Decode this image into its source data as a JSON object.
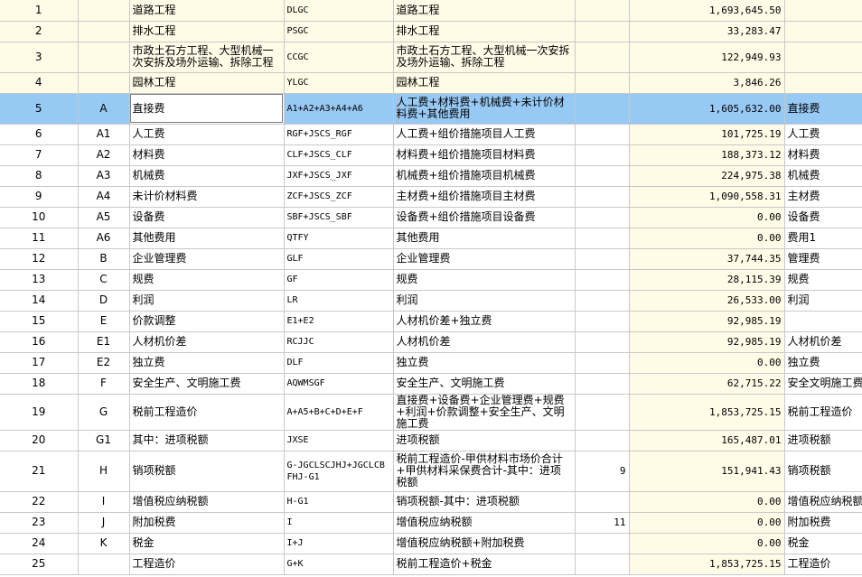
{
  "columns": [
    "no",
    "code",
    "name",
    "base",
    "desc",
    "rate",
    "amount",
    "category"
  ],
  "rows": [
    {
      "no": "1",
      "code": "",
      "name": "道路工程",
      "base": "DLGC",
      "desc": "道路工程",
      "rate": "",
      "amount": "1,693,645.50",
      "category": ""
    },
    {
      "no": "2",
      "code": "",
      "name": "排水工程",
      "base": "PSGC",
      "desc": "排水工程",
      "rate": "",
      "amount": "33,283.47",
      "category": ""
    },
    {
      "no": "3",
      "code": "",
      "name": "市政土石方工程、大型机械一次安拆及场外运输、拆除工程",
      "base": "CCGC",
      "desc": "市政土石方工程、大型机械一次安拆及场外运输、拆除工程",
      "rate": "",
      "amount": "122,949.93",
      "category": ""
    },
    {
      "no": "4",
      "code": "",
      "name": "园林工程",
      "base": "YLGC",
      "desc": "园林工程",
      "rate": "",
      "amount": "3,846.26",
      "category": ""
    },
    {
      "no": "5",
      "code": "A",
      "name": "直接费",
      "base": "A1+A2+A3+A4+A6",
      "desc": "人工费+材料费+机械费+未计价材料费+其他费用",
      "rate": "",
      "amount": "1,605,632.00",
      "category": "直接费"
    },
    {
      "no": "6",
      "code": "A1",
      "name": "人工费",
      "base": "RGF+JSCS_RGF",
      "desc": "人工费+组价措施项目人工费",
      "rate": "",
      "amount": "101,725.19",
      "category": "人工费"
    },
    {
      "no": "7",
      "code": "A2",
      "name": "材料费",
      "base": "CLF+JSCS_CLF",
      "desc": "材料费+组价措施项目材料费",
      "rate": "",
      "amount": "188,373.12",
      "category": "材料费"
    },
    {
      "no": "8",
      "code": "A3",
      "name": "机械费",
      "base": "JXF+JSCS_JXF",
      "desc": "机械费+组价措施项目机械费",
      "rate": "",
      "amount": "224,975.38",
      "category": "机械费"
    },
    {
      "no": "9",
      "code": "A4",
      "name": "未计价材料费",
      "base": "ZCF+JSCS_ZCF",
      "desc": "主材费+组价措施项目主材费",
      "rate": "",
      "amount": "1,090,558.31",
      "category": "主材费"
    },
    {
      "no": "10",
      "code": "A5",
      "name": "设备费",
      "base": "SBF+JSCS_SBF",
      "desc": "设备费+组价措施项目设备费",
      "rate": "",
      "amount": "0.00",
      "category": "设备费"
    },
    {
      "no": "11",
      "code": "A6",
      "name": "其他费用",
      "base": "QTFY",
      "desc": "其他费用",
      "rate": "",
      "amount": "0.00",
      "category": "费用1"
    },
    {
      "no": "12",
      "code": "B",
      "name": "企业管理费",
      "base": "GLF",
      "desc": "企业管理费",
      "rate": "",
      "amount": "37,744.35",
      "category": "管理费"
    },
    {
      "no": "13",
      "code": "C",
      "name": "规费",
      "base": "GF",
      "desc": "规费",
      "rate": "",
      "amount": "28,115.39",
      "category": "规费"
    },
    {
      "no": "14",
      "code": "D",
      "name": "利润",
      "base": "LR",
      "desc": "利润",
      "rate": "",
      "amount": "26,533.00",
      "category": "利润"
    },
    {
      "no": "15",
      "code": "E",
      "name": "价款调整",
      "base": "E1+E2",
      "desc": "人材机价差+独立费",
      "rate": "",
      "amount": "92,985.19",
      "category": ""
    },
    {
      "no": "16",
      "code": "E1",
      "name": "人材机价差",
      "base": "RCJJC",
      "desc": "人材机价差",
      "rate": "",
      "amount": "92,985.19",
      "category": "人材机价差"
    },
    {
      "no": "17",
      "code": "E2",
      "name": "独立费",
      "base": "DLF",
      "desc": "独立费",
      "rate": "",
      "amount": "0.00",
      "category": "独立费"
    },
    {
      "no": "18",
      "code": "F",
      "name": "安全生产、文明施工费",
      "base": "AQWMSGF",
      "desc": "安全生产、文明施工费",
      "rate": "",
      "amount": "62,715.22",
      "category": "安全文明施工费"
    },
    {
      "no": "19",
      "code": "G",
      "name": "税前工程造价",
      "base": "A+A5+B+C+D+E+F",
      "desc": "直接费+设备费+企业管理费+规费+利润+价款调整+安全生产、文明施工费",
      "rate": "",
      "amount": "1,853,725.15",
      "category": "税前工程造价"
    },
    {
      "no": "20",
      "code": "G1",
      "name": "其中：进项税额",
      "base": "JXSE",
      "desc": "进项税额",
      "rate": "",
      "amount": "165,487.01",
      "category": "进项税额"
    },
    {
      "no": "21",
      "code": "H",
      "name": "销项税额",
      "base": "G-JGCLSCJHJ+JGCLCBFHJ-G1",
      "desc": "税前工程造价-甲供材料市场价合计+甲供材料采保费合计-其中：进项税额",
      "rate": "9",
      "amount": "151,941.43",
      "category": "销项税额"
    },
    {
      "no": "22",
      "code": "I",
      "name": "增值税应纳税额",
      "base": "H-G1",
      "desc": "销项税额-其中：进项税额",
      "rate": "",
      "amount": "0.00",
      "category": "增值税应纳税额"
    },
    {
      "no": "23",
      "code": "J",
      "name": "附加税费",
      "base": "I",
      "desc": "增值税应纳税额",
      "rate": "11",
      "amount": "0.00",
      "category": "附加税费"
    },
    {
      "no": "24",
      "code": "K",
      "name": "税金",
      "base": "I+J",
      "desc": "增值税应纳税额+附加税费",
      "rate": "",
      "amount": "0.00",
      "category": "税金"
    },
    {
      "no": "25",
      "code": "",
      "name": "工程造价",
      "base": "G+K",
      "desc": "税前工程造价+税金",
      "rate": "",
      "amount": "1,853,725.15",
      "category": "工程造价"
    }
  ],
  "selected_row": "5",
  "colors": {
    "selection": "#97c9f5",
    "subtotal_bg": "#fffbe7",
    "grid_line": "#c8c8c8"
  }
}
